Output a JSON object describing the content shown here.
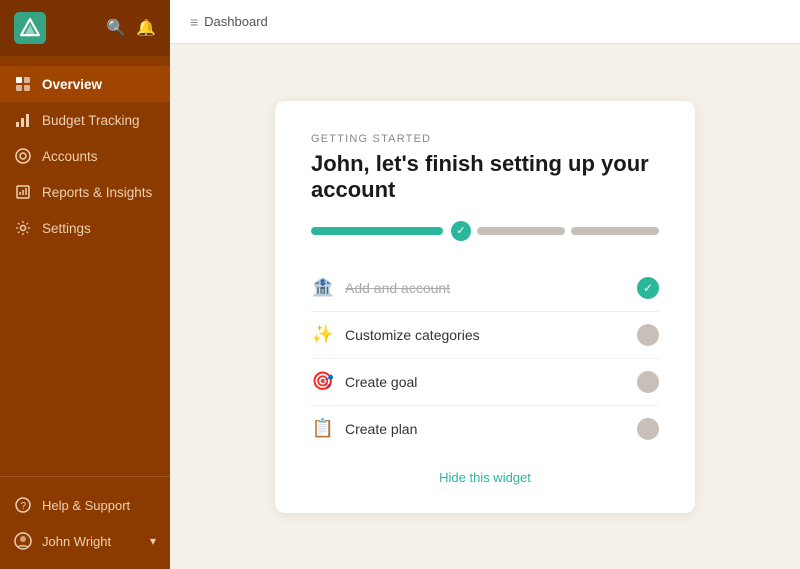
{
  "sidebar": {
    "logo_alt": "App logo",
    "nav_items": [
      {
        "id": "overview",
        "label": "Overview",
        "active": true
      },
      {
        "id": "budget-tracking",
        "label": "Budget Tracking",
        "active": false
      },
      {
        "id": "accounts",
        "label": "Accounts",
        "active": false
      },
      {
        "id": "reports-insights",
        "label": "Reports & Insights",
        "active": false
      },
      {
        "id": "settings",
        "label": "Settings",
        "active": false
      }
    ],
    "help_label": "Help & Support",
    "user_name": "John Wright",
    "user_chevron": "expand-icon"
  },
  "topbar": {
    "menu_icon": "≡",
    "breadcrumb": "Dashboard"
  },
  "widget": {
    "getting_started_label": "GETTING STARTED",
    "title": "John, let's finish setting up your account",
    "steps": [
      {
        "id": "add-account",
        "emoji": "🏦",
        "label": "Add and account",
        "done": true
      },
      {
        "id": "customize-categories",
        "emoji": "✨",
        "label": "Customize categories",
        "done": false
      },
      {
        "id": "create-goal",
        "emoji": "🎯",
        "label": "Create goal",
        "done": false
      },
      {
        "id": "create-plan",
        "emoji": "📋",
        "label": "Create plan",
        "done": false
      }
    ],
    "hide_widget_label": "Hide this widget",
    "progress_segments": [
      {
        "state": "done"
      },
      {
        "state": "partial"
      },
      {
        "state": "partial"
      }
    ]
  }
}
